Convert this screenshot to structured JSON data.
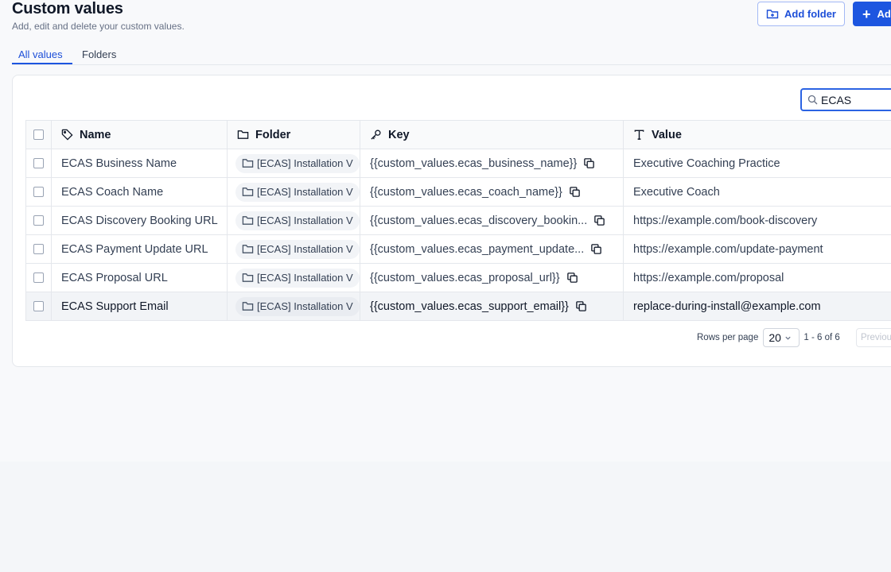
{
  "header": {
    "title": "Custom values",
    "subtitle": "Add, edit and delete your custom values.",
    "add_folder_label": "Add folder",
    "add_label": "Ad"
  },
  "tabs": [
    {
      "label": "All values",
      "active": true
    },
    {
      "label": "Folders",
      "active": false
    }
  ],
  "search": {
    "value": "ECAS"
  },
  "table": {
    "columns": {
      "name": "Name",
      "folder": "Folder",
      "key": "Key",
      "value": "Value"
    },
    "rows": [
      {
        "name": "ECAS Business Name",
        "folder": "[ECAS] Installation V",
        "key": "{{custom_values.ecas_business_name}}",
        "value": "Executive Coaching Practice"
      },
      {
        "name": "ECAS Coach Name",
        "folder": "[ECAS] Installation V",
        "key": "{{custom_values.ecas_coach_name}}",
        "value": "Executive Coach"
      },
      {
        "name": "ECAS Discovery Booking URL",
        "folder": "[ECAS] Installation V",
        "key": "{{custom_values.ecas_discovery_bookin...",
        "value": "https://example.com/book-discovery"
      },
      {
        "name": "ECAS Payment Update URL",
        "folder": "[ECAS] Installation V",
        "key": "{{custom_values.ecas_payment_update...",
        "value": "https://example.com/update-payment"
      },
      {
        "name": "ECAS Proposal URL",
        "folder": "[ECAS] Installation V",
        "key": "{{custom_values.ecas_proposal_url}}",
        "value": "https://example.com/proposal"
      },
      {
        "name": "ECAS Support Email",
        "folder": "[ECAS] Installation V",
        "key": "{{custom_values.ecas_support_email}}",
        "value": "replace-during-install@example.com"
      }
    ]
  },
  "pagination": {
    "rows_per_page_label": "Rows per page",
    "rows_per_page": "20",
    "range": "1 - 6 of 6",
    "previous_label": "Previous"
  },
  "colors": {
    "accent": "#1d56e0",
    "link": "#1d4fd8",
    "border": "#e4e7ec"
  }
}
